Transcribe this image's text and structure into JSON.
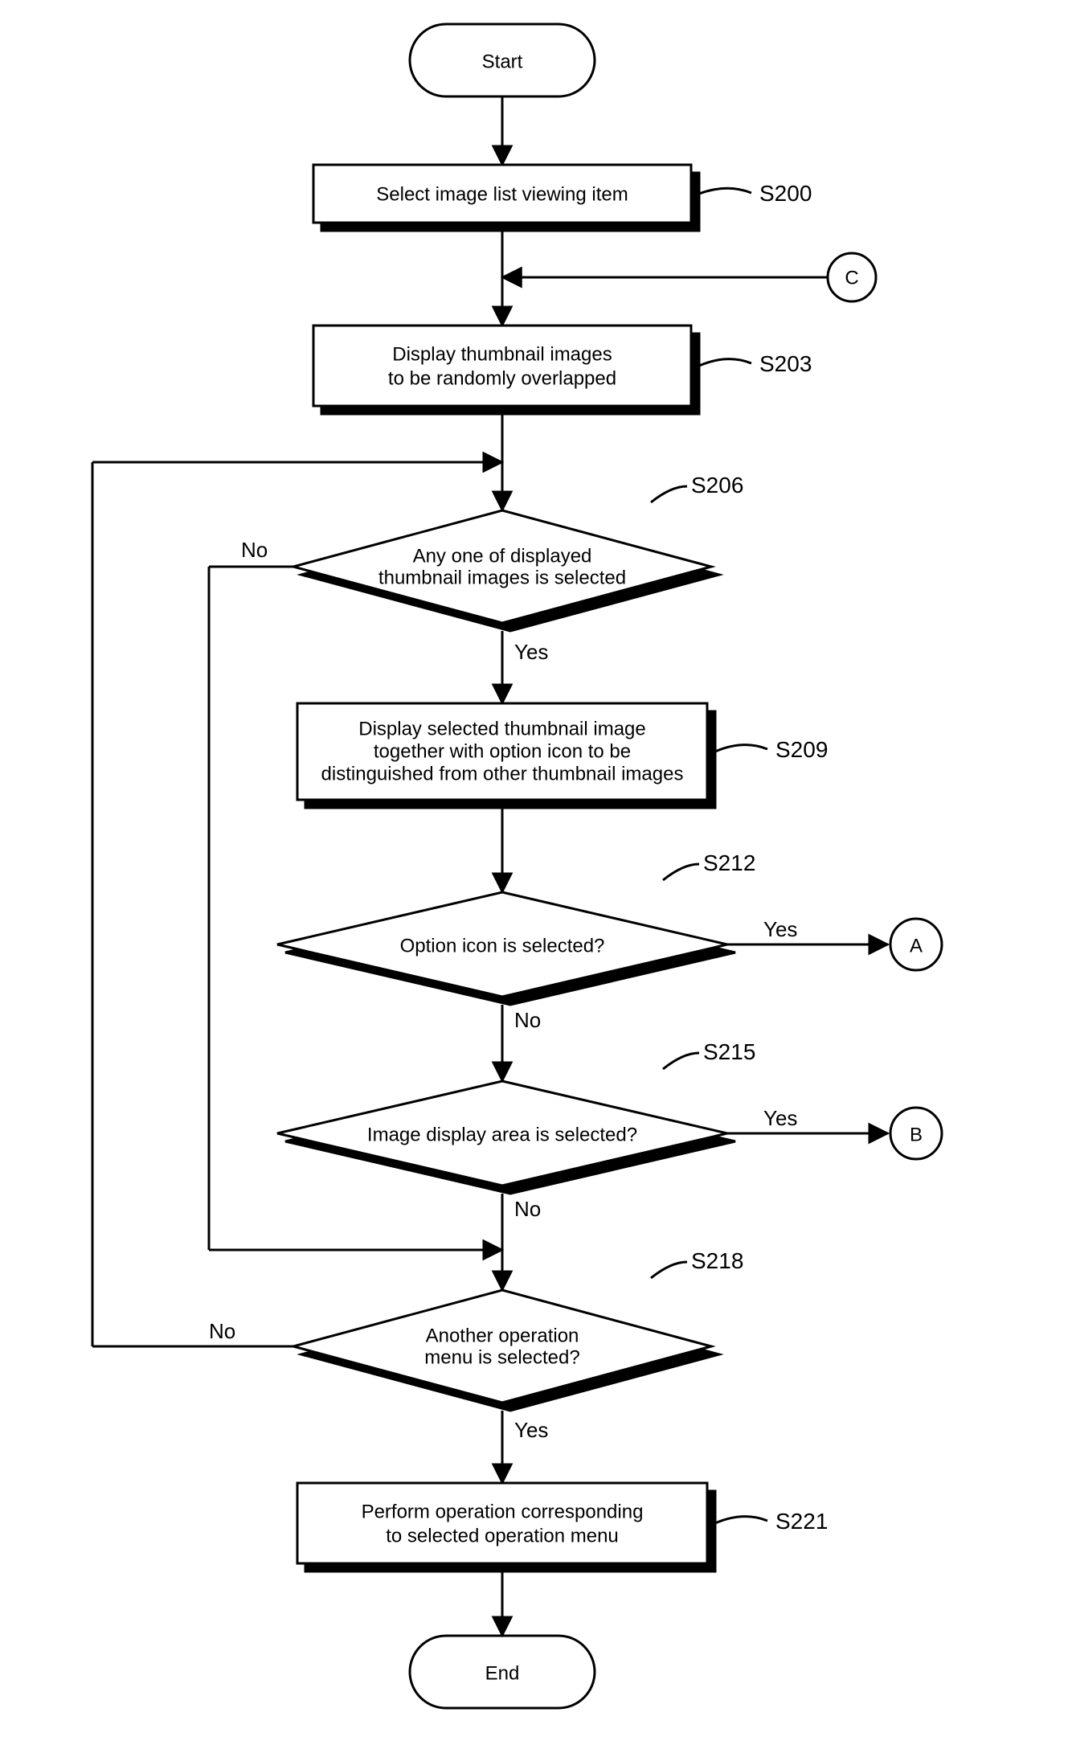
{
  "chart_data": {
    "type": "flowchart",
    "nodes": [
      {
        "id": "start",
        "type": "terminator",
        "text": "Start"
      },
      {
        "id": "s200",
        "type": "process",
        "text": "Select image list viewing item",
        "label": "S200"
      },
      {
        "id": "connC_in",
        "type": "connector",
        "text": "C"
      },
      {
        "id": "s203",
        "type": "process",
        "text": "Display thumbnail images\nto be randomly overlapped",
        "label": "S203"
      },
      {
        "id": "s206",
        "type": "decision",
        "text": "Any one of displayed\nthumbnail images is selected",
        "label": "S206"
      },
      {
        "id": "s209",
        "type": "process",
        "text": "Display selected thumbnail image\ntogether with option icon to be\ndistinguished from other thumbnail images",
        "label": "S209"
      },
      {
        "id": "s212",
        "type": "decision",
        "text": "Option icon is selected?",
        "label": "S212"
      },
      {
        "id": "connA",
        "type": "connector",
        "text": "A"
      },
      {
        "id": "s215",
        "type": "decision",
        "text": "Image display area is selected?",
        "label": "S215"
      },
      {
        "id": "connB",
        "type": "connector",
        "text": "B"
      },
      {
        "id": "s218",
        "type": "decision",
        "text": "Another operation\nmenu is selected?",
        "label": "S218"
      },
      {
        "id": "s221",
        "type": "process",
        "text": "Perform operation corresponding\nto selected operation menu",
        "label": "S221"
      },
      {
        "id": "end",
        "type": "terminator",
        "text": "End"
      }
    ],
    "edges": [
      {
        "from": "start",
        "to": "s200"
      },
      {
        "from": "s200",
        "to": "merge_c"
      },
      {
        "from": "connC_in",
        "to": "merge_c"
      },
      {
        "from": "merge_c",
        "to": "s203"
      },
      {
        "from": "s203",
        "to": "merge_left"
      },
      {
        "from": "merge_left",
        "to": "s206"
      },
      {
        "from": "s206",
        "to": "s209",
        "label": "Yes"
      },
      {
        "from": "s206",
        "to": "merge_no_loop",
        "label": "No"
      },
      {
        "from": "s209",
        "to": "s212"
      },
      {
        "from": "s212",
        "to": "connA",
        "label": "Yes"
      },
      {
        "from": "s212",
        "to": "s215",
        "label": "No"
      },
      {
        "from": "s215",
        "to": "connB",
        "label": "Yes"
      },
      {
        "from": "s215",
        "to": "s218_merge",
        "label": "No"
      },
      {
        "from": "merge_no_loop",
        "to": "s218_merge"
      },
      {
        "from": "s218_merge",
        "to": "s218"
      },
      {
        "from": "s218",
        "to": "merge_left",
        "label": "No"
      },
      {
        "from": "s218",
        "to": "s221",
        "label": "Yes"
      },
      {
        "from": "s221",
        "to": "end"
      }
    ]
  },
  "labels": {
    "start": "Start",
    "end": "End",
    "s200_text": "Select image list viewing item",
    "s200_lbl": "S200",
    "s203_l1": "Display thumbnail images",
    "s203_l2": "to be randomly overlapped",
    "s203_lbl": "S203",
    "s206_l1": "Any one of displayed",
    "s206_l2": "thumbnail images is selected",
    "s206_lbl": "S206",
    "s209_l1": "Display selected thumbnail image",
    "s209_l2": "together with option icon to be",
    "s209_l3": "distinguished from other thumbnail images",
    "s209_lbl": "S209",
    "s212_text": "Option icon is selected?",
    "s212_lbl": "S212",
    "s215_text": "Image display area is selected?",
    "s215_lbl": "S215",
    "s218_l1": "Another operation",
    "s218_l2": "menu is selected?",
    "s218_lbl": "S218",
    "s221_l1": "Perform operation corresponding",
    "s221_l2": "to selected operation menu",
    "s221_lbl": "S221",
    "yes": "Yes",
    "no": "No",
    "connA": "A",
    "connB": "B",
    "connC": "C"
  }
}
